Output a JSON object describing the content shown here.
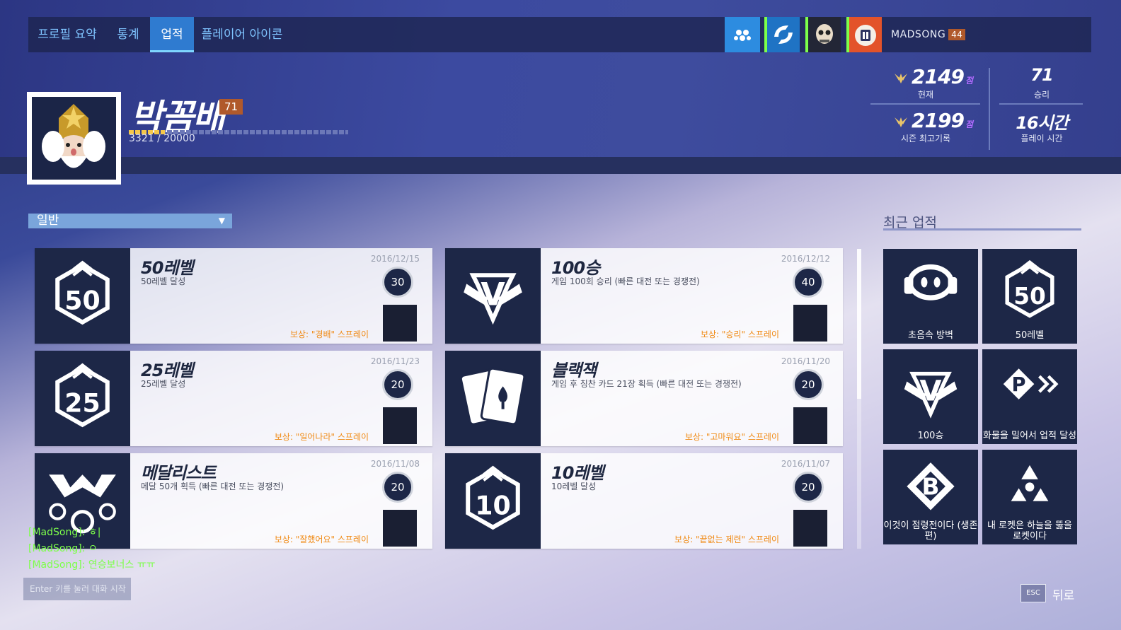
{
  "nav": {
    "tabs": [
      {
        "label": "프로필 요약"
      },
      {
        "label": "통계"
      },
      {
        "label": "업적"
      },
      {
        "label": "플레이어 아이콘"
      }
    ],
    "active_tab": "업적",
    "player_name": "MADSONG",
    "player_level": "44"
  },
  "profile": {
    "name": "박꼼배",
    "level": "71",
    "xp_text": "3321 / 20000",
    "xp_progress": 0.166
  },
  "stats": {
    "current_value": "2149",
    "current_unit": "점",
    "current_label": "현재",
    "best_value": "2199",
    "best_unit": "점",
    "best_label": "시즌 최고기록",
    "wins_value": "71",
    "wins_label": "승리",
    "time_value": "16시간",
    "time_label": "플레이 시간"
  },
  "filter": {
    "selected": "일반"
  },
  "achievements": [
    {
      "title": "50레벨",
      "desc": "50레벨 달성",
      "date": "2016/12/15",
      "points": "30",
      "reward": "보상: \"경배\" 스프레이",
      "icon": "level-50-icon"
    },
    {
      "title": "100승",
      "desc": "게임 100회 승리 (빠른 대전 또는 경쟁전)",
      "date": "2016/12/12",
      "points": "40",
      "reward": "보상: \"승리\" 스프레이",
      "icon": "victory-wings-icon"
    },
    {
      "title": "25레벨",
      "desc": "25레벨 달성",
      "date": "2016/11/23",
      "points": "20",
      "reward": "보상: \"일어나라\" 스프레이",
      "icon": "level-25-icon"
    },
    {
      "title": "블랙잭",
      "desc": "게임 후 칭찬 카드 21장 획득 (빠른 대전 또는 경쟁전)",
      "date": "2016/11/20",
      "points": "20",
      "reward": "보상: \"고마워요\" 스프레이",
      "icon": "cards-icon"
    },
    {
      "title": "메달리스트",
      "desc": "메달 50개 획득 (빠른 대전 또는 경쟁전)",
      "date": "2016/11/08",
      "points": "20",
      "reward": "보상: \"잘했어요\" 스프레이",
      "icon": "medals-icon"
    },
    {
      "title": "10레벨",
      "desc": "10레벨 달성",
      "date": "2016/11/07",
      "points": "20",
      "reward": "보상: \"끝없는 제련\" 스프레이",
      "icon": "level-10-icon"
    }
  ],
  "recent": {
    "title": "최근 업적",
    "items": [
      {
        "label": "초음속 방벽",
        "icon": "headphones-icon"
      },
      {
        "label": "50레벨",
        "icon": "level-50-icon"
      },
      {
        "label": "100승",
        "icon": "victory-wings-icon"
      },
      {
        "label": "화물을 밀어서 업적 달성",
        "icon": "payload-icon"
      },
      {
        "label": "이것이 점령전이다 (생존편)",
        "icon": "point-b-icon"
      },
      {
        "label": "내 로켓은 하늘을 뚫을 로켓이다",
        "icon": "radiation-icon"
      }
    ]
  },
  "chat": {
    "lines": [
      "[MadSong]: ㅎ|",
      "[MadSong]: ㅇ",
      "[MadSong]: 연승보너스 ㅠㅠ"
    ],
    "input_placeholder": "Enter 키를 눌러 대화 시작"
  },
  "footer": {
    "esc_key": "ESC",
    "back_label": "뒤로"
  },
  "colors": {
    "tab_active": "#2f7bd0",
    "tab_text": "#7fc4ff",
    "reward": "#f08a14",
    "chat": "#7dff4a",
    "level_badge": "#b0592b",
    "skill_rating": "#b26bff"
  }
}
